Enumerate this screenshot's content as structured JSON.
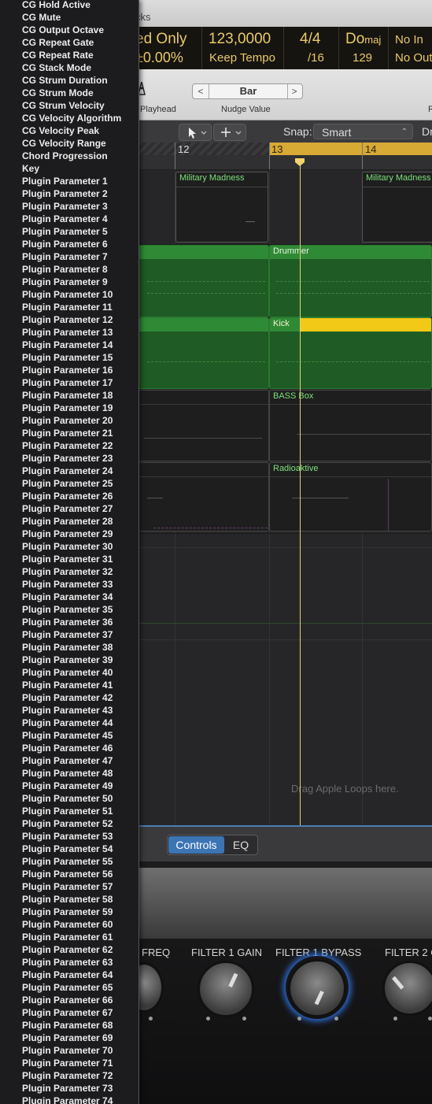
{
  "window": {
    "title_fragment": "cks"
  },
  "lcd": {
    "mode": "ed Only",
    "offset": "±0.00%",
    "tempo": "123,0000",
    "tempo_mode": "Keep Tempo",
    "signature_top": "4/4",
    "signature_bottom": "/16",
    "key": "Do",
    "key_suffix": "maj",
    "bpm_value": "129",
    "in_text": "No In",
    "out_text": "No Out"
  },
  "control_bar": {
    "playhead_label": "Playhead",
    "nudge_value": "Bar",
    "nudge_label": "Nudge Value",
    "right_fragment": "R"
  },
  "tracks_toolbar": {
    "snap_label": "Snap:",
    "snap_value": "Smart",
    "drag_fragment": "Dr"
  },
  "ruler": {
    "bars": [
      "12",
      "13",
      "14"
    ]
  },
  "regions": [
    {
      "name": "Military Madness"
    },
    {
      "name": "Military Madness"
    },
    {
      "name": "Drummer"
    },
    {
      "name": "Kick"
    },
    {
      "name": "BASS Box"
    },
    {
      "name": "Radioaktive"
    }
  ],
  "drop_hint": "Drag Apple Loops here.",
  "plugin": {
    "tabs": [
      "Controls",
      "EQ"
    ],
    "knobs": [
      "FREQ",
      "FILTER 1 GAIN",
      "FILTER 1 BYPASS",
      "FILTER 2 C"
    ]
  },
  "menu": {
    "items": [
      "CG Hold Active",
      "CG Mute",
      "CG Output Octave",
      "CG Repeat Gate",
      "CG Repeat Rate",
      "CG Stack Mode",
      "CG Strum Duration",
      "CG Strum Mode",
      "CG Strum Velocity",
      "CG Velocity Algorithm",
      "CG Velocity Peak",
      "CG Velocity Range",
      "Chord Progression",
      "Key",
      "Plugin Parameter 1",
      "Plugin Parameter 2",
      "Plugin Parameter 3",
      "Plugin Parameter 4",
      "Plugin Parameter 5",
      "Plugin Parameter 6",
      "Plugin Parameter 7",
      "Plugin Parameter 8",
      "Plugin Parameter 9",
      "Plugin Parameter 10",
      "Plugin Parameter 11",
      "Plugin Parameter 12",
      "Plugin Parameter 13",
      "Plugin Parameter 14",
      "Plugin Parameter 15",
      "Plugin Parameter 16",
      "Plugin Parameter 17",
      "Plugin Parameter 18",
      "Plugin Parameter 19",
      "Plugin Parameter 20",
      "Plugin Parameter 21",
      "Plugin Parameter 22",
      "Plugin Parameter 23",
      "Plugin Parameter 24",
      "Plugin Parameter 25",
      "Plugin Parameter 26",
      "Plugin Parameter 27",
      "Plugin Parameter 28",
      "Plugin Parameter 29",
      "Plugin Parameter 30",
      "Plugin Parameter 31",
      "Plugin Parameter 32",
      "Plugin Parameter 33",
      "Plugin Parameter 34",
      "Plugin Parameter 35",
      "Plugin Parameter 36",
      "Plugin Parameter 37",
      "Plugin Parameter 38",
      "Plugin Parameter 39",
      "Plugin Parameter 40",
      "Plugin Parameter 41",
      "Plugin Parameter 42",
      "Plugin Parameter 43",
      "Plugin Parameter 44",
      "Plugin Parameter 45",
      "Plugin Parameter 46",
      "Plugin Parameter 47",
      "Plugin Parameter 48",
      "Plugin Parameter 49",
      "Plugin Parameter 50",
      "Plugin Parameter 51",
      "Plugin Parameter 52",
      "Plugin Parameter 53",
      "Plugin Parameter 54",
      "Plugin Parameter 55",
      "Plugin Parameter 56",
      "Plugin Parameter 57",
      "Plugin Parameter 58",
      "Plugin Parameter 59",
      "Plugin Parameter 60",
      "Plugin Parameter 61",
      "Plugin Parameter 62",
      "Plugin Parameter 63",
      "Plugin Parameter 64",
      "Plugin Parameter 65",
      "Plugin Parameter 66",
      "Plugin Parameter 67",
      "Plugin Parameter 68",
      "Plugin Parameter 69",
      "Plugin Parameter 70",
      "Plugin Parameter 71",
      "Plugin Parameter 72",
      "Plugin Parameter 73",
      "Plugin Parameter 74"
    ]
  },
  "colors": {
    "accent": "#4a7fb5",
    "lcd_text": "#e8c96a",
    "cycle": "#d7a935",
    "drummer_green": "#2f8a35",
    "region_label_green": "#7ee07a"
  }
}
